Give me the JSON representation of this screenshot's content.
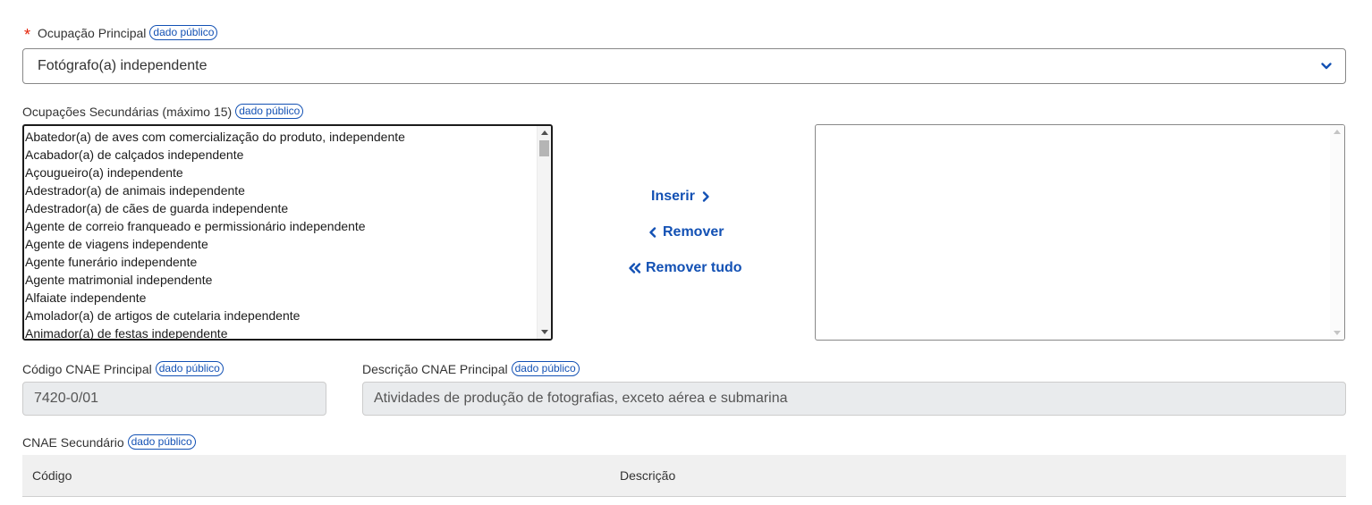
{
  "badge_label": "dado público",
  "accent_color": "#1351b4",
  "required_color": "#e52207",
  "ocupacao_principal": {
    "required_mark": "*",
    "label": "Ocupação Principal",
    "selected_value": "Fotógrafo(a) independente",
    "chevron_icon": "chevron-down-icon"
  },
  "ocupacoes_secundarias": {
    "label": "Ocupações Secundárias (máximo 15)",
    "available_options": [
      "Abatedor(a) de aves com comercialização do produto, independente",
      "Acabador(a) de calçados independente",
      "Açougueiro(a) independente",
      "Adestrador(a) de animais independente",
      "Adestrador(a) de cães de guarda independente",
      "Agente de correio franqueado e permissionário independente",
      "Agente de viagens independente",
      "Agente funerário independente",
      "Agente matrimonial independente",
      "Alfaiate independente",
      "Amolador(a) de artigos de cutelaria independente",
      "Animador(a) de festas independente"
    ],
    "selected_options": [],
    "actions": {
      "insert_label": "Inserir",
      "remove_label": "Remover",
      "remove_all_label": "Remover tudo"
    }
  },
  "cnae_principal": {
    "codigo_label": "Código CNAE Principal",
    "codigo_value": "7420-0/01",
    "descricao_label": "Descrição CNAE Principal",
    "descricao_value": "Atividades de produção de fotografias, exceto aérea e submarina"
  },
  "cnae_secundario": {
    "label": "CNAE Secundário",
    "columns": [
      "Código",
      "Descrição"
    ]
  }
}
